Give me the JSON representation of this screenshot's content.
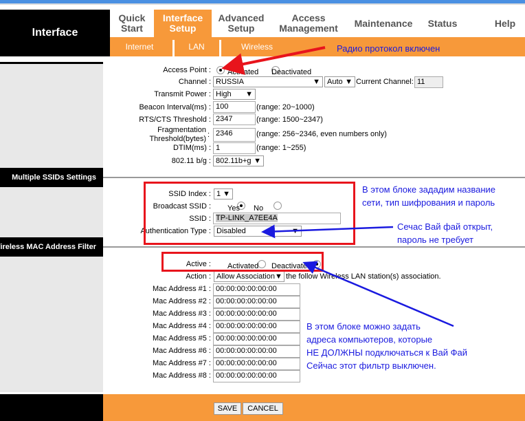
{
  "header": {
    "title": "Interface"
  },
  "menu": [
    {
      "label": "Quick\nStart"
    },
    {
      "label": "Interface\nSetup"
    },
    {
      "label": "Advanced\nSetup"
    },
    {
      "label": "Access\nManagement"
    },
    {
      "label": "Maintenance"
    },
    {
      "label": "Status"
    },
    {
      "label": "Help"
    }
  ],
  "submenu": [
    "Internet",
    "LAN",
    "Wireless"
  ],
  "accent": "#f7993a",
  "wireless": {
    "access_point_label": "Access Point :",
    "ap_activated": "Activated",
    "ap_deactivated": "Deactivated",
    "ap_value": "Activated",
    "channel_label": "Channel :",
    "channel_region": "RUSSIA",
    "channel_value": "Auto",
    "current_channel_label": "Current Channel:",
    "current_channel": "11",
    "tx_power_label": "Transmit Power :",
    "tx_power": "High",
    "beacon_label": "Beacon Interval(ms) :",
    "beacon": "100",
    "beacon_range": "(range: 20~1000)",
    "rts_label": "RTS/CTS Threshold :",
    "rts": "2347",
    "rts_range": "(range: 1500~2347)",
    "frag_label1": "Fragmentation",
    "frag_label2": "Threshold(bytes)",
    "frag_colon": ":",
    "frag": "2346",
    "frag_range": "(range: 256~2346, even numbers only)",
    "dtim_label": "DTIM(ms) :",
    "dtim": "1",
    "dtim_range": "(range: 1~255)",
    "mode_label": "802.11 b/g :",
    "mode": "802.11b+g"
  },
  "ssid_section": {
    "title": "Multiple SSIDs Settings",
    "index_label": "SSID Index :",
    "index": "1",
    "broadcast_label": "Broadcast SSID :",
    "yes": "Yes",
    "no": "No",
    "broadcast_value": "Yes",
    "ssid_label": "SSID :",
    "ssid": "TP-LINK_A7EE4A",
    "auth_label": "Authentication Type :",
    "auth": "Disabled"
  },
  "mac_section": {
    "title": "Wireless MAC Address Filter",
    "active_label": "Active :",
    "activated": "Activated",
    "deactivated": "Deactivated",
    "active_value": "Deactivated",
    "action_label": "Action :",
    "action": "Allow Association",
    "action_suffix": "the follow Wireless LAN station(s) association.",
    "addresses": [
      {
        "label": "Mac Address #1 :",
        "value": "00:00:00:00:00:00"
      },
      {
        "label": "Mac Address #2 :",
        "value": "00:00:00:00:00:00"
      },
      {
        "label": "Mac Address #3 :",
        "value": "00:00:00:00:00:00"
      },
      {
        "label": "Mac Address #4 :",
        "value": "00:00:00:00:00:00"
      },
      {
        "label": "Mac Address #5 :",
        "value": "00:00:00:00:00:00"
      },
      {
        "label": "Mac Address #6 :",
        "value": "00:00:00:00:00:00"
      },
      {
        "label": "Mac Address #7 :",
        "value": "00:00:00:00:00:00"
      },
      {
        "label": "Mac Address #8 :",
        "value": "00:00:00:00:00:00"
      }
    ]
  },
  "buttons": {
    "save": "SAVE",
    "cancel": "CANCEL"
  },
  "annotations": {
    "radio": "Радио протокол включен",
    "ssid_block": [
      "В этом блоке зададим название",
      "сети, тип шифрования и пароль"
    ],
    "open_wifi": [
      "Сечас Вай фай открыт,",
      "пароль не требует"
    ],
    "mac_block": [
      "В этом блоке можно задать",
      "адреса компьютеров, которые",
      "НЕ ДОЛЖНЫ подключаться к Вай Фай",
      "Сейчас этот фильтр выключен."
    ]
  }
}
